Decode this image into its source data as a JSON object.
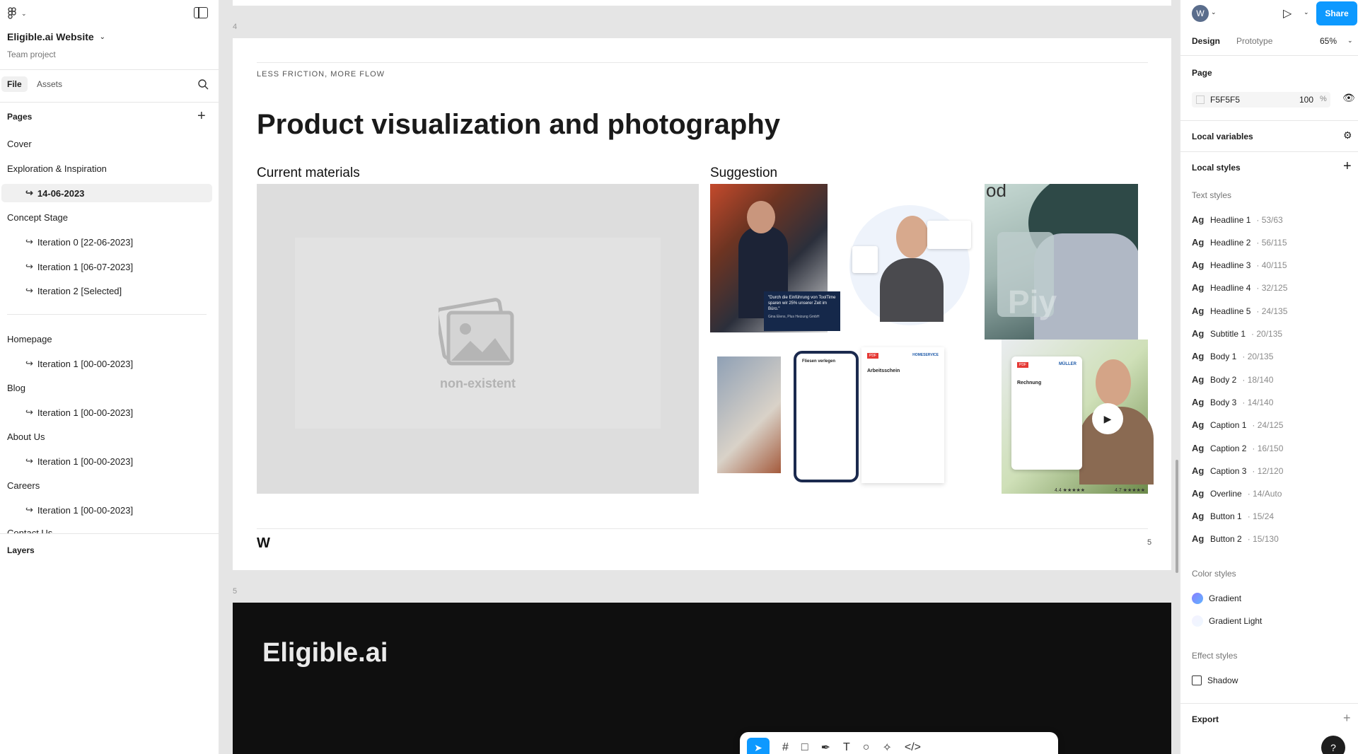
{
  "file": {
    "name": "Eligible.ai Website",
    "type": "Team project"
  },
  "left_tabs": {
    "file": "File",
    "assets": "Assets"
  },
  "pages_title": "Pages",
  "pages": [
    {
      "label": "Cover"
    },
    {
      "label": "Exploration & Inspiration"
    },
    {
      "label": "14-06-2023"
    },
    {
      "label": "Concept Stage"
    },
    {
      "label": "Iteration 0 [22-06-2023]"
    },
    {
      "label": "Iteration 1 [06-07-2023]"
    },
    {
      "label": "Iteration 2 [Selected]"
    },
    {
      "label": "Homepage"
    },
    {
      "label": "Iteration 1 [00-00-2023]"
    },
    {
      "label": "Blog"
    },
    {
      "label": "Iteration 1 [00-00-2023]"
    },
    {
      "label": "About Us"
    },
    {
      "label": "Iteration 1 [00-00-2023]"
    },
    {
      "label": "Careers"
    },
    {
      "label": "Iteration 1 [00-00-2023]"
    },
    {
      "label": "Contact Us"
    }
  ],
  "layers_title": "Layers",
  "right": {
    "avatar": "W",
    "share": "Share",
    "tabs": {
      "design": "Design",
      "prototype": "Prototype"
    },
    "zoom": "65%",
    "page_label": "Page",
    "page_color": "F5F5F5",
    "page_opacity": "100",
    "pct": "%",
    "local_variables": "Local variables",
    "local_styles": "Local styles",
    "text_styles_label": "Text styles",
    "text_styles": [
      {
        "name": "Headline 1",
        "value": "· 53/63"
      },
      {
        "name": "Headline 2",
        "value": "· 56/115"
      },
      {
        "name": "Headline 3",
        "value": "· 40/115"
      },
      {
        "name": "Headline 4",
        "value": "· 32/125"
      },
      {
        "name": "Headline 5",
        "value": "· 24/135"
      },
      {
        "name": "Subtitle 1",
        "value": "· 20/135"
      },
      {
        "name": "Body 1",
        "value": "· 20/135"
      },
      {
        "name": "Body 2",
        "value": "· 18/140"
      },
      {
        "name": "Body 3",
        "value": "· 14/140"
      },
      {
        "name": "Caption 1",
        "value": "· 24/125"
      },
      {
        "name": "Caption 2",
        "value": "· 16/150"
      },
      {
        "name": "Caption 3",
        "value": "· 12/120"
      },
      {
        "name": "Overline",
        "value": "· 14/Auto"
      },
      {
        "name": "Button 1",
        "value": "· 15/24"
      },
      {
        "name": "Button 2",
        "value": "· 15/130"
      }
    ],
    "ag": "Ag",
    "color_styles_label": "Color styles",
    "color_styles": [
      {
        "name": "Gradient"
      },
      {
        "name": "Gradient Light"
      }
    ],
    "effect_styles_label": "Effect styles",
    "effect_styles": [
      {
        "name": "Shadow"
      }
    ],
    "export": "Export",
    "help": "?"
  },
  "canvas": {
    "frame_num_a": "4",
    "frame_num_b": "5",
    "overline": "LESS FRICTION, MORE FLOW",
    "title": "Product visualization and photography",
    "current": "Current materials",
    "suggestion": "Suggestion",
    "nonexistent": "non-existent",
    "page_no": "5",
    "brand": "Eligible.ai",
    "quote": "\"Durch die Einführung von ToolTime sparen wir 25% unserer Zeit im Büro.\"",
    "quote_author": "Gina Elens, Plus Heizung GmbH",
    "phone_title": "Fliesen verlegen",
    "doc1_badge": "PDF",
    "doc1_title": "Arbeitsschein",
    "doc1_brand": "HOMESERVICE",
    "doc2_badge": "PDF",
    "doc2_title": "Rechnung",
    "doc2_brand": "MÜLLER",
    "rating1": "4.4 ★★★★★",
    "rating2": "4.7 ★★★★★",
    "piy": "Piy",
    "od": "od"
  }
}
